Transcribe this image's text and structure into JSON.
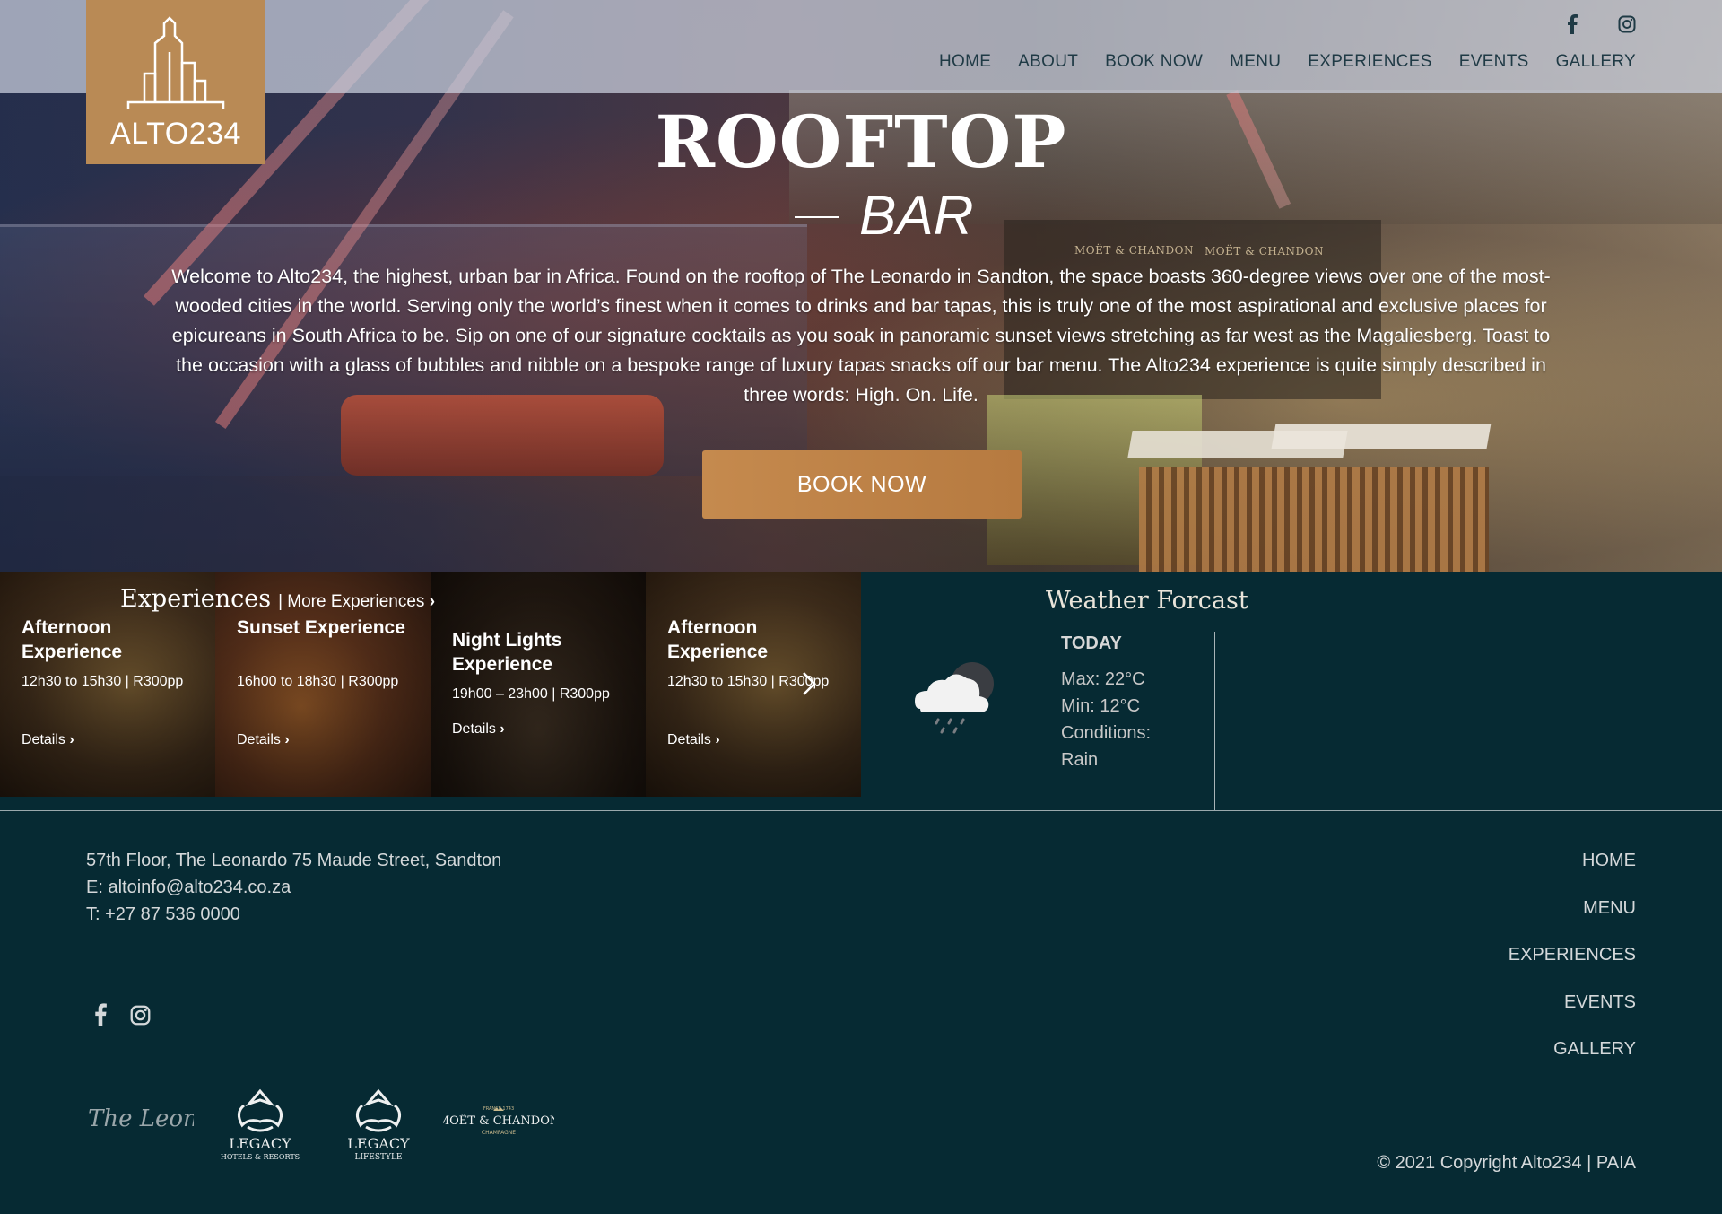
{
  "logo": {
    "text": "ALTO234"
  },
  "nav": [
    "HOME",
    "ABOUT",
    "BOOK NOW",
    "MENU",
    "EXPERIENCES",
    "EVENTS",
    "GALLERY"
  ],
  "hero": {
    "title": "ROOFTOP",
    "subtitle": "BAR",
    "body": "Welcome to Alto234, the highest, urban bar in Africa. Found on the rooftop of The Leonardo in Sandton, the space boasts 360-degree views over one of the most-wooded cities in the world. Serving only the world’s finest when it comes to drinks and bar tapas, this is truly one of the most aspirational and exclusive places for epicureans in South Africa to be. Sip on one of our signature cocktails as you soak in panoramic sunset views stretching as far west as the Magaliesberg. Toast to the occasion with a glass of bubbles and nibble on a bespoke range of luxury tapas snacks off our bar menu. The Alto234 experience is quite simply described in three words: High. On. Life.",
    "button": "BOOK NOW",
    "brand_marks": [
      "MOËT & CHANDON",
      "MOËT & CHANDON"
    ]
  },
  "experiences": {
    "title": "Experiences",
    "more": "| More Experiences",
    "cards": [
      {
        "title": "Afternoon Experience",
        "time": "12h30 to 15h30 | R300pp",
        "details": "Details"
      },
      {
        "title": "Sunset Experience",
        "time": "16h00 to 18h30 | R300pp",
        "details": "Details"
      },
      {
        "title": "Night Lights Experience",
        "time": "19h00 – 23h00 | R300pp",
        "details": "Details"
      },
      {
        "title": "Afternoon Experience",
        "time": "12h30 to 15h30 | R300pp",
        "details": "Details"
      }
    ]
  },
  "weather": {
    "title": "Weather Forcast",
    "day": "TODAY",
    "max": "Max: 22°C",
    "min": "Min: 12°C",
    "conditions_label": "Conditions:",
    "conditions": "Rain",
    "icon": "rain-cloud-icon"
  },
  "footer": {
    "address": "57th Floor, The Leonardo 75 Maude Street, Sandton",
    "email": "E: altoinfo@alto234.co.za",
    "phone": "T: +27 87 536 0000",
    "nav": [
      "HOME",
      "MENU",
      "EXPERIENCES",
      "EVENTS",
      "GALLERY"
    ],
    "partners": [
      {
        "name": "The Leonardo"
      },
      {
        "name": "LEGACY",
        "sub": "HOTELS & RESORTS"
      },
      {
        "name": "LEGACY",
        "sub": "LIFESTYLE"
      },
      {
        "name": "MOËT & CHANDON",
        "top": "FRANCE 1743",
        "sub": "CHAMPAGNE"
      }
    ],
    "copyright": "© 2021 Copyright Alto234 | PAIA"
  },
  "colors": {
    "accent": "#b98a55",
    "dark": "#062a33",
    "nav_text": "#1f3a45"
  }
}
